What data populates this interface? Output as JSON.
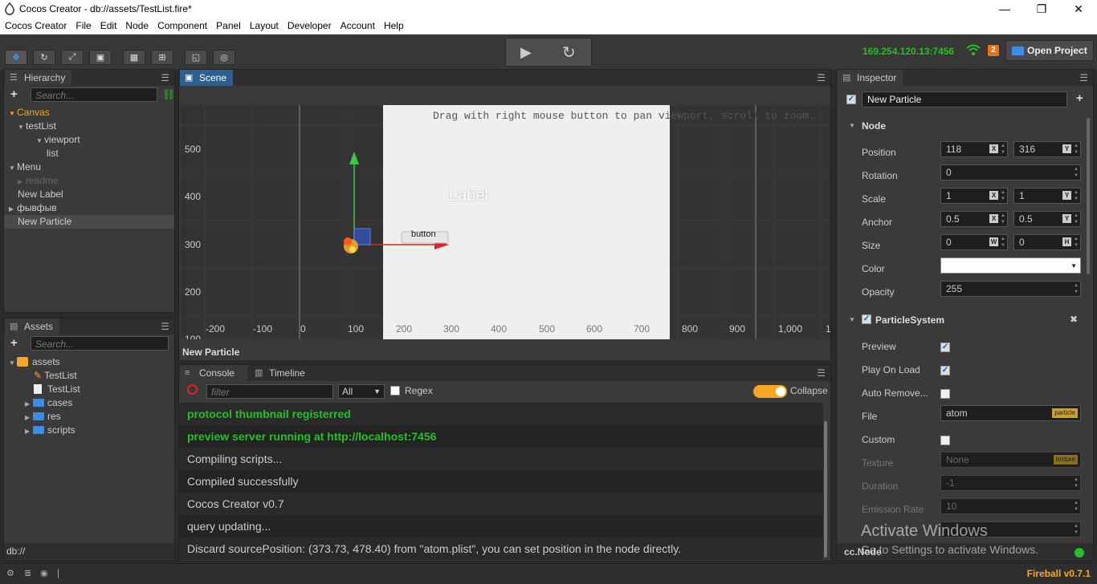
{
  "window": {
    "title": "Cocos Creator - db://assets/TestList.fire*",
    "minimize": "—",
    "maximize": "❐",
    "close": "✕"
  },
  "menu": [
    "Cocos Creator",
    "File",
    "Edit",
    "Node",
    "Component",
    "Panel",
    "Layout",
    "Developer",
    "Account",
    "Help"
  ],
  "toolbar": {
    "tools": [
      "move-icon",
      "rotate-icon",
      "scale-icon",
      "rect-icon",
      "local-icon",
      "pivot-icon",
      "anchor-icon",
      "gizmo-icon"
    ],
    "play": "▶",
    "refresh": "↻",
    "ip": "169.254.120.13:7456",
    "device_count": "2",
    "open_project": "Open Project"
  },
  "hierarchy": {
    "title": "Hierarchy",
    "search_placeholder": "Search...",
    "add": "+",
    "nodes": [
      {
        "label": "Canvas"
      },
      {
        "label": "testList"
      },
      {
        "label": "viewport"
      },
      {
        "label": "list"
      },
      {
        "label": "Menu"
      },
      {
        "label": "readme"
      },
      {
        "label": "New Label"
      },
      {
        "label": "фывфыв"
      },
      {
        "label": "New Particle"
      }
    ]
  },
  "assets": {
    "title": "Assets",
    "search_placeholder": "Search...",
    "add": "+",
    "items": [
      {
        "label": "assets"
      },
      {
        "label": "TestList"
      },
      {
        "label": "TestList"
      },
      {
        "label": "cases"
      },
      {
        "label": "res"
      },
      {
        "label": "scripts"
      }
    ],
    "footer": "db://"
  },
  "scene": {
    "title": "Scene",
    "hint": "Drag with right mouse button to pan viewport, scroll to zoom.",
    "y_ticks": [
      "500",
      "400",
      "300",
      "200",
      "100"
    ],
    "x_ticks": [
      "-200",
      "-100",
      "0",
      "100",
      "200",
      "300",
      "400",
      "500",
      "600",
      "700",
      "800",
      "900",
      "1,000",
      "1"
    ],
    "label_text": "Label",
    "button_text": "button",
    "selected_node": "New Particle"
  },
  "console": {
    "tab_console": "Console",
    "tab_timeline": "Timeline",
    "filter_placeholder": "filter",
    "level": "All",
    "regex": "Regex",
    "collapse": "Collapse",
    "logs": [
      {
        "text": "protocol thumbnail registerred",
        "type": "green"
      },
      {
        "text": "preview server running at http://localhost:7456",
        "type": "green"
      },
      {
        "text": "Compiling scripts...",
        "type": "normal"
      },
      {
        "text": "Compiled successfully",
        "type": "normal"
      },
      {
        "text": "Cocos Creator v0.7",
        "type": "normal"
      },
      {
        "text": "query updating...",
        "type": "normal"
      },
      {
        "text": "Discard sourcePosition: (373.73, 478.40) from \"atom.plist\", you can set position in the node directly.",
        "type": "normal"
      }
    ]
  },
  "inspector": {
    "title": "Inspector",
    "node_name": "New Particle",
    "node_section": "Node",
    "position_label": "Position",
    "position_x": "118",
    "position_y": "316",
    "rotation_label": "Rotation",
    "rotation": "0",
    "scale_label": "Scale",
    "scale_x": "1",
    "scale_y": "1",
    "anchor_label": "Anchor",
    "anchor_x": "0.5",
    "anchor_y": "0.5",
    "size_label": "Size",
    "size_w": "0",
    "size_h": "0",
    "color_label": "Color",
    "opacity_label": "Opacity",
    "opacity": "255",
    "particle_section": "ParticleSystem",
    "preview_label": "Preview",
    "play_on_load_label": "Play On Load",
    "auto_remove_label": "Auto Remove...",
    "file_label": "File",
    "file_value": "atom",
    "file_tag": "particle",
    "custom_label": "Custom",
    "texture_label": "Texture",
    "texture_value": "None",
    "texture_tag": "texture",
    "duration_label": "Duration",
    "duration": "-1",
    "emission_label": "Emission Rate",
    "emission": "10",
    "footer": "cc.Node",
    "tag_x": "X",
    "tag_y": "Y",
    "tag_w": "W",
    "tag_h": "H",
    "watermark_1": "Activate Windows",
    "watermark_2": "Go to Settings to activate Windows."
  },
  "statusbar": {
    "version": "Fireball v0.7.1"
  },
  "colors": {
    "accent": "#2f5f8f",
    "green": "#25c025",
    "orange": "#f5a623",
    "gizmo_red": "#e22020",
    "gizmo_green": "#3ec63e"
  }
}
